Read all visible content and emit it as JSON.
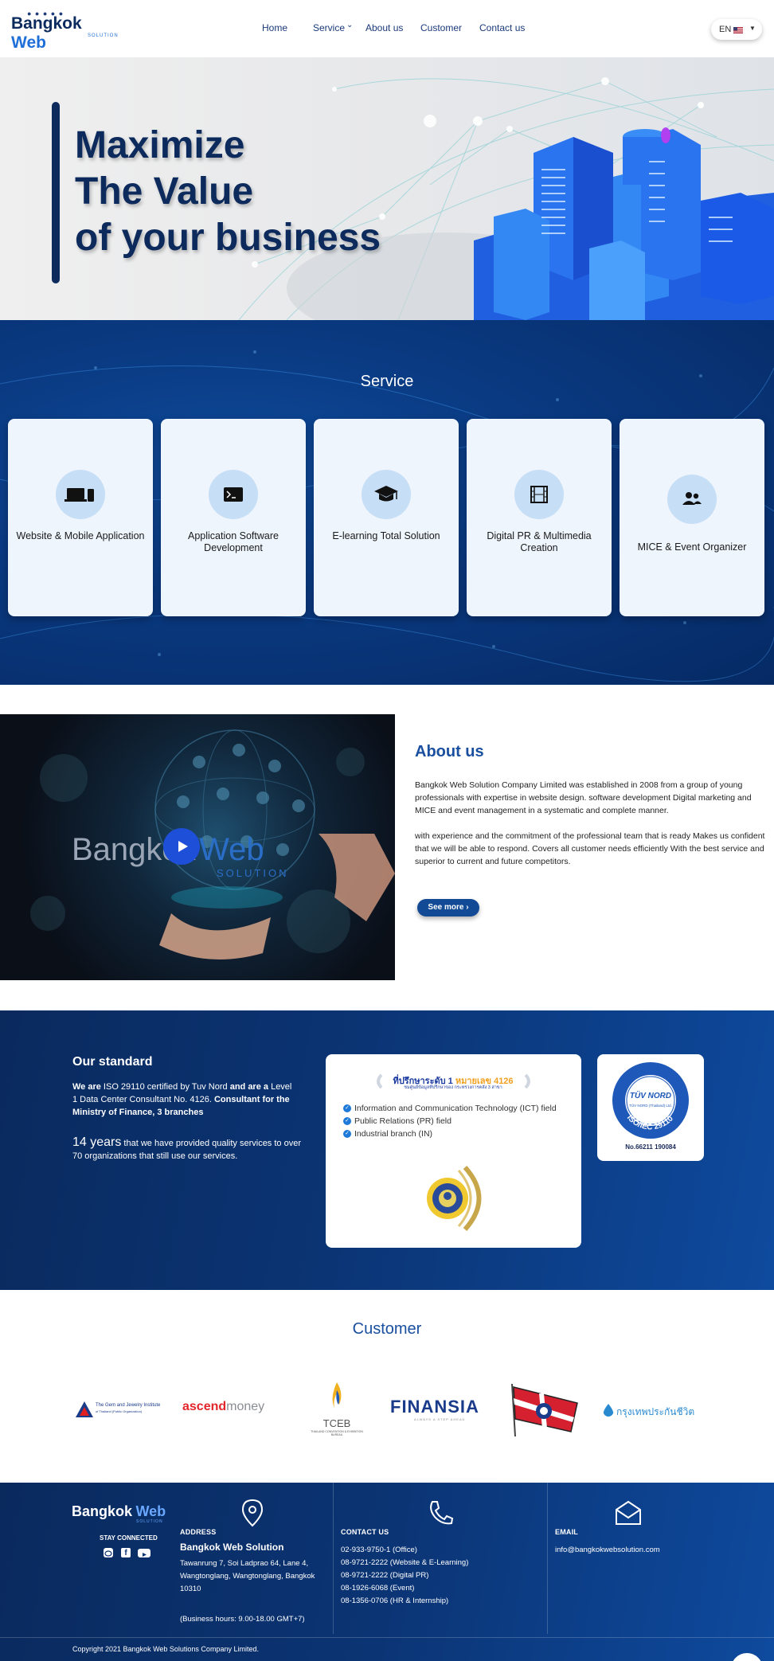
{
  "header": {
    "logo_part1": "Bangkok",
    "logo_part2": "Web",
    "logo_sub": "SOLUTION",
    "nav": [
      {
        "label": "Home"
      },
      {
        "label": "Service"
      },
      {
        "label": "About us"
      },
      {
        "label": "Customer"
      },
      {
        "label": "Contact us"
      }
    ],
    "language": "EN"
  },
  "hero": {
    "line1": "Maximize",
    "line2": "The Value",
    "line3": "of your business"
  },
  "service": {
    "title": "Service",
    "cards": [
      {
        "label": "Website & Mobile Application",
        "icon": "devices-icon"
      },
      {
        "label": "Application Software Development",
        "icon": "terminal-icon"
      },
      {
        "label": "E-learning Total Solution",
        "icon": "graduation-cap-icon"
      },
      {
        "label": "Digital PR & Multimedia Creation",
        "icon": "film-icon"
      },
      {
        "label": "MICE & Event Organizer",
        "icon": "users-icon"
      }
    ]
  },
  "about": {
    "title": "About us",
    "paragraph1": "Bangkok Web Solution Company Limited was established in 2008 from a group of young professionals with expertise in website design. software development Digital marketing and MICE and event management in a systematic and complete manner.",
    "paragraph2": "with experience and the commitment of the professional team that is ready Makes us confident that we will be able to respond. Covers all customer needs efficiently With the best service and superior to current and future competitors.",
    "button": "See more",
    "video_logo_part1": "Bangkok",
    "video_logo_part2": "Web",
    "video_logo_sub": "SOLUTION"
  },
  "standard": {
    "title": "Our standard",
    "p1_a": "We are",
    "p1_b": " ISO 29110 certified by Tuv Nord ",
    "p1_c": "and are a",
    "p1_d": " Level 1 Data Center Consultant No. 4126.",
    "p1_e": "Consultant for the Ministry of Finance, 3 branches",
    "p2_big": "14 years",
    "p2_rest": " that we have provided quality services to over 70 organizations that still use our services.",
    "cert_head_a": "ที่ปรึกษาระดับ 1",
    "cert_head_b": "หมายเลข 4126",
    "cert_sub": "ชมศูนย์ข้อมูลที่ปรึกษาของ กระทรวงการคลัง 3 สาขา",
    "cert_items": [
      "Information and Communication Technology (ICT) field",
      "Public Relations (PR) field",
      "Industrial branch (IN)"
    ],
    "tuv_text1": "TÜV NORD",
    "tuv_text2": "TÜV NORD (Thailand) Ltd.",
    "tuv_ring": "ISO/IEC 29110",
    "tuv_caption": "No.66211 190084"
  },
  "customer": {
    "title": "Customer",
    "logos": [
      {
        "name": "The Gem and Jewelry Institute",
        "sub": "of Thailand (Public Organization)"
      },
      {
        "name": "ascend",
        "name2": "money"
      },
      {
        "name": "TCEB",
        "sub": "THAILAND CONVENTION & EXHIBITION BUREAU"
      },
      {
        "name": "FINANSIA",
        "sub": "ALWAYS A STEP AHEAD"
      },
      {
        "name": "flag-logo"
      },
      {
        "name": "กรุงเทพประกันชีวิต"
      }
    ]
  },
  "footer": {
    "logo_part1": "Bangkok",
    "logo_part2": "Web",
    "logo_sub": "SOLUTION",
    "stay_connected": "STAY CONNECTED",
    "address_label": "ADDRESS",
    "address_company": "Bangkok Web Solution",
    "address_lines": [
      "Tawanrung 7, Soi Ladprao 64, Lane 4,",
      "Wangtonglang, Wangtonglang, Bangkok",
      "10310"
    ],
    "hours": "(Business hours: 9.00-18.00 GMT+7)",
    "contact_label": "CONTACT US",
    "contacts": [
      "02-933-9750-1 (Office)",
      "08-9721-2222 (Website & E-Learning)",
      "08-9721-2222 (Digital PR)",
      "08-1926-6068 (Event)",
      "08-1356-0706 (HR & Internship)"
    ],
    "email_label": "EMAIL",
    "email": "info@bangkokwebsolution.com",
    "copyright": "Copyright 2021 Bangkok Web Solutions Company Limited."
  },
  "colors": {
    "primary_dark": "#0c2a5c",
    "accent_blue": "#1a4fa0",
    "service_card_bg": "#eef5fd",
    "icon_circle": "#c6def6"
  }
}
